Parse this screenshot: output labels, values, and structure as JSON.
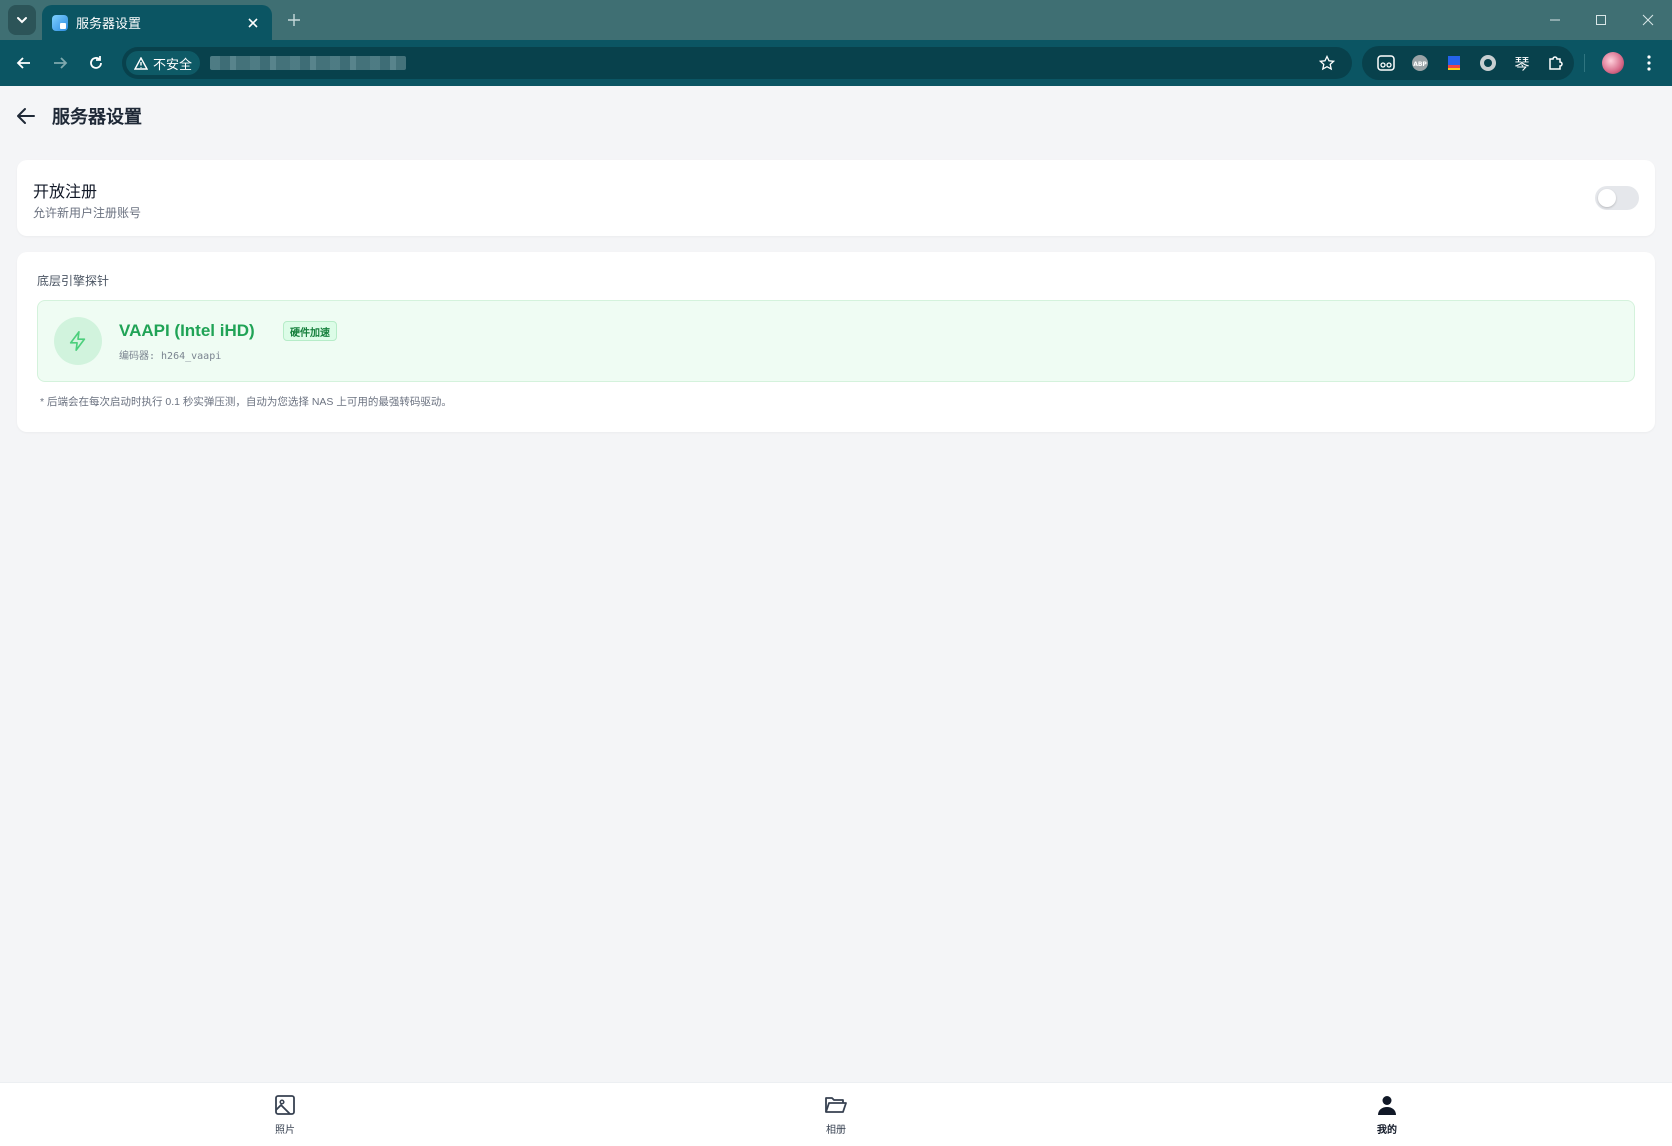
{
  "browser": {
    "tab_title": "服务器设置",
    "security_label": "不安全",
    "extensions": [
      "reader-icon",
      "abp-icon",
      "flag-icon",
      "record-icon",
      "琴",
      "puzzle-icon"
    ],
    "ext_text_label": "琴"
  },
  "header": {
    "title": "服务器设置"
  },
  "registration": {
    "title": "开放注册",
    "description": "允许新用户注册账号",
    "enabled": false
  },
  "probe": {
    "section_title": "底层引擎探针",
    "engine_name": "VAAPI (Intel iHD)",
    "badge": "硬件加速",
    "encoder_label": "编码器: h264_vaapi",
    "note": "* 后端会在每次启动时执行 0.1 秒实弹压测，自动为您选择 NAS 上可用的最强转码驱动。"
  },
  "bottom_nav": [
    {
      "label": "照片",
      "icon": "image-icon",
      "active": false
    },
    {
      "label": "相册",
      "icon": "folder-open-icon",
      "active": false
    },
    {
      "label": "我的",
      "icon": "user-icon",
      "active": true
    }
  ],
  "colors": {
    "chrome": "#0b5563",
    "accent_green": "#20a356",
    "probe_bg": "#effcf3"
  }
}
